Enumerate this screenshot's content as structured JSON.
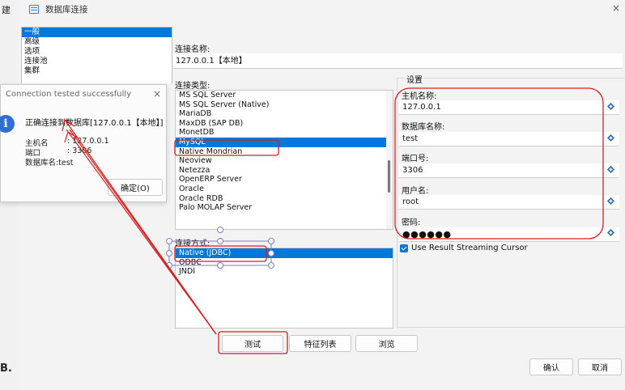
{
  "background": {
    "left_char_top": "建",
    "left_char_bottom": "B.",
    "left_small": "⋮"
  },
  "window": {
    "title": "数据库连接",
    "close": "×"
  },
  "categories": [
    {
      "label": "一般",
      "active": true
    },
    {
      "label": "高级",
      "active": false
    },
    {
      "label": "选项",
      "active": false
    },
    {
      "label": "连接池",
      "active": false
    },
    {
      "label": "集群",
      "active": false
    }
  ],
  "connection": {
    "name_label": "连接名称:",
    "name_value": "127.0.0.1【本地】",
    "type_label": "连接类型:",
    "method_label": "连接方式:"
  },
  "drivers": [
    {
      "label": "MS SQL Server",
      "active": false
    },
    {
      "label": "MS SQL Server (Native)",
      "active": false
    },
    {
      "label": "MariaDB",
      "active": false
    },
    {
      "label": "MaxDB (SAP DB)",
      "active": false
    },
    {
      "label": "MonetDB",
      "active": false
    },
    {
      "label": "MySQL",
      "active": true
    },
    {
      "label": "Native Mondrian",
      "active": false
    },
    {
      "label": "Neoview",
      "active": false
    },
    {
      "label": "Netezza",
      "active": false
    },
    {
      "label": "OpenERP Server",
      "active": false
    },
    {
      "label": "Oracle",
      "active": false
    },
    {
      "label": "Oracle RDB",
      "active": false
    },
    {
      "label": "Palo MOLAP Server",
      "active": false
    }
  ],
  "methods": [
    {
      "label": "Native (JDBC)",
      "active": true
    },
    {
      "label": "ODBC",
      "active": false
    },
    {
      "label": "JNDI",
      "active": false
    }
  ],
  "settings": {
    "legend": "设置",
    "host_label": "主机名称:",
    "host_value": "127.0.0.1",
    "db_label": "数据库名称:",
    "db_value": "test",
    "port_label": "端口号:",
    "port_value": "3306",
    "user_label": "用户名:",
    "user_value": "root",
    "password_label": "密码:",
    "password_value": "●●●●●●",
    "streaming_label": "Use Result Streaming Cursor",
    "streaming_checked": true
  },
  "buttons": {
    "test": "测试",
    "features": "特征列表",
    "browse": "浏览",
    "ok": "确认",
    "cancel": "取消"
  },
  "popup": {
    "title": "Connection tested successfully",
    "close": "×",
    "icon": "i",
    "message": "正确连接到数据库[127.0.0.1【本地】]",
    "host_label": "主机名",
    "host_value": ": 127.0.0.1",
    "port_label": "端口",
    "port_value": ": 3306",
    "db_line": "数据库名:test",
    "ok": "确定(O)"
  },
  "colors": {
    "selection": "#0078d7",
    "annotation": "#d81e1e",
    "accent_diamond": "#2f6aa8"
  },
  "icons": {
    "window": "database-connection-icon",
    "info": "info-icon",
    "field_action": "diamond-variable-icon"
  }
}
